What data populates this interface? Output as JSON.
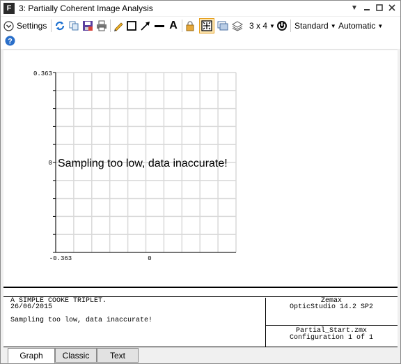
{
  "window": {
    "title": "3: Partially Coherent Image Analysis",
    "app_icon_letter": "F"
  },
  "toolbar": {
    "settings_label": "Settings",
    "layout_label": "3 x 4",
    "standard_label": "Standard",
    "automatic_label": "Automatic",
    "text_tool_glyph": "A"
  },
  "chart_data": {
    "type": "heatmap",
    "ytick_top": "0.363",
    "ytick_mid": "0",
    "xtick_left": "-0.363",
    "xtick_mid": "0",
    "message": "Sampling too low, data inaccurate!",
    "grid": true
  },
  "footer": {
    "left_line1": "A SIMPLE COOKE TRIPLET.",
    "left_line2": "26/06/2015",
    "left_line3": "Sampling too low, data inaccurate!",
    "right_top_line1": "Zemax",
    "right_top_line2": "OpticStudio 14.2 SP2",
    "right_bottom_line1": "Partial_Start.zmx",
    "right_bottom_line2": "Configuration 1 of 1"
  },
  "tabs": [
    {
      "label": "Graph",
      "active": true
    },
    {
      "label": "Classic",
      "active": false
    },
    {
      "label": "Text",
      "active": false
    }
  ]
}
